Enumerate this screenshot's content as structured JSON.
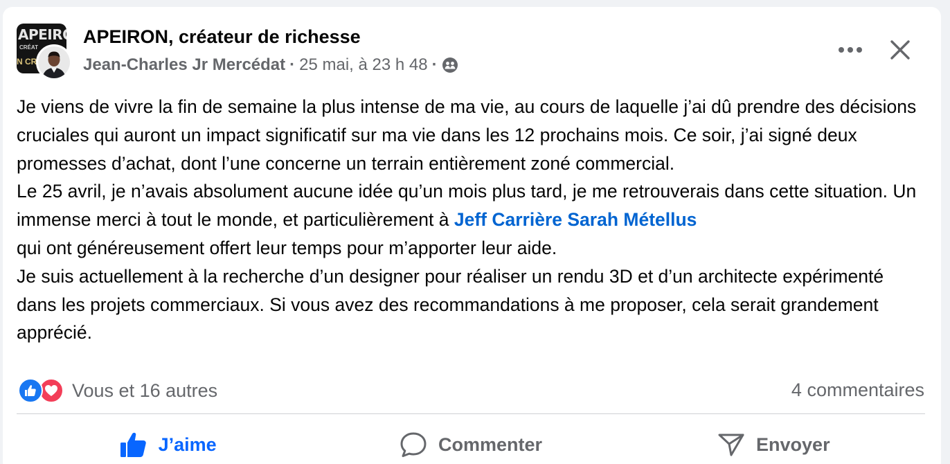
{
  "post": {
    "page_name": "APEIRON, créateur de richesse",
    "author": "Jean-Charles Jr Mercédat",
    "separator": "·",
    "date": "25 mai, à 23 h 48",
    "avatar_logo_line1": "APEIRO",
    "avatar_logo_line2": "CRÉAT",
    "avatar_logo_line3": "N CRÉ",
    "paragraphs": {
      "p1": "Je viens de vivre la fin de semaine la plus intense de ma vie, au cours de laquelle j’ai dû prendre des décisions cruciales qui auront un impact significatif sur ma vie dans les 12 prochains mois. Ce soir, j’ai signé deux promesses d’achat, dont l’une concerne un terrain entièrement zoné commercial.",
      "p2_before": "Le 25 avril, je n’avais absolument aucune idée qu’un mois plus tard, je me retrouverais dans cette situation. Un immense merci à tout le monde, et particulièrement à ",
      "mention1": "Jeff Carrière",
      "mention2": "Sarah Métellus",
      "p2_after": "qui ont généreusement offert leur temps pour m’apporter leur aide.",
      "p3": "Je suis actuellement à la recherche d’un designer pour réaliser un rendu 3D et d’un architecte expérimenté dans les projets commerciaux. Si vous avez des recommandations à me proposer, cela serait grandement apprécié."
    }
  },
  "stats": {
    "reactions_text": "Vous et 16 autres",
    "comments_text": "4 commentaires"
  },
  "actions": {
    "like": "J’aime",
    "comment": "Commenter",
    "send": "Envoyer"
  },
  "colors": {
    "link": "#0064d1",
    "like_active": "#0866ff",
    "love": "#f33e58",
    "muted": "#65676b"
  },
  "icons": {
    "audience": "friends-audience-icon",
    "more": "more-horizontal-icon",
    "close": "close-icon",
    "like_reaction": "like-reaction-icon",
    "love_reaction": "love-reaction-icon",
    "like_action": "thumbs-up-icon",
    "comment_action": "comment-bubble-icon",
    "send_action": "send-icon"
  }
}
